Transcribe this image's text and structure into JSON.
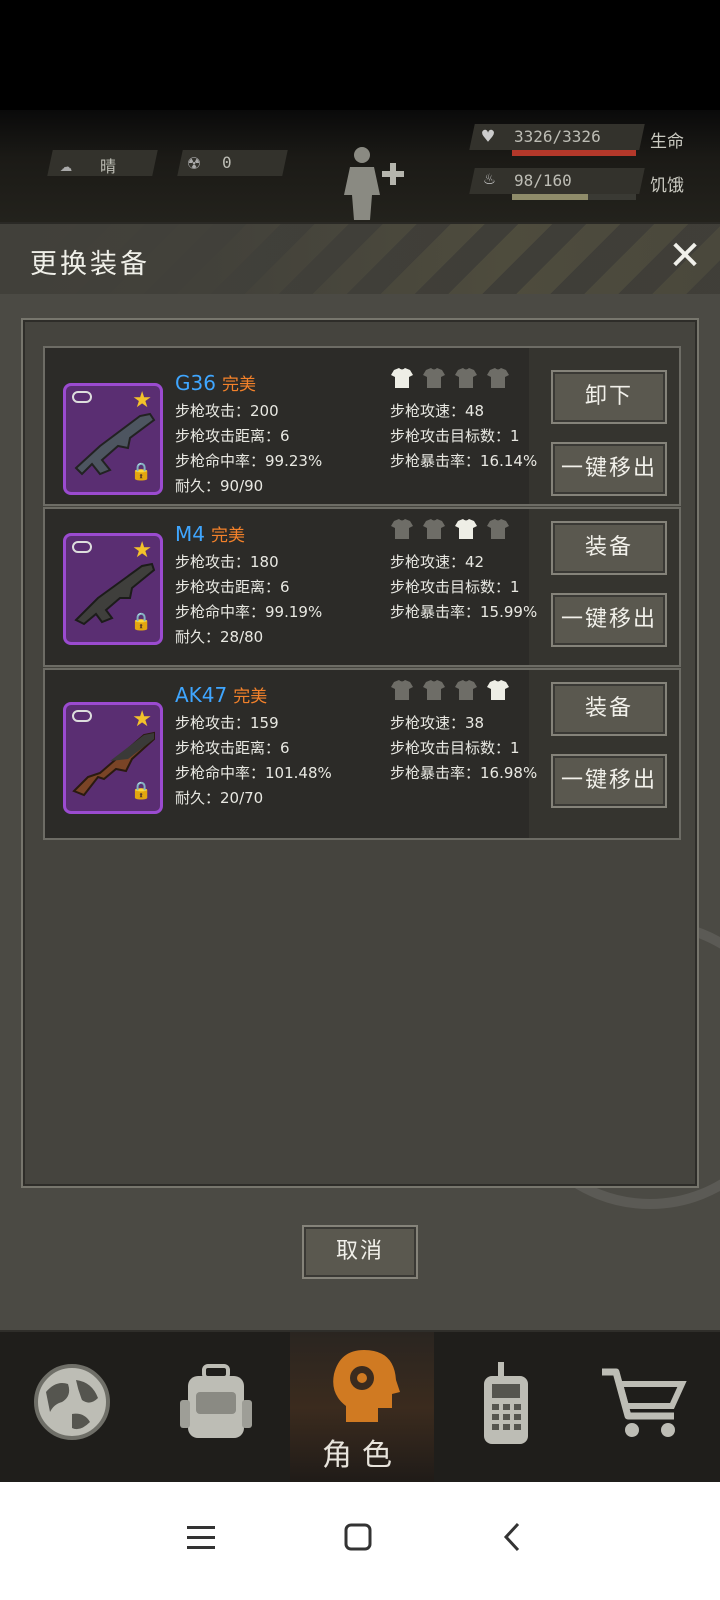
{
  "hud": {
    "weather": "晴",
    "radiation": "0",
    "hp": "3326/3326",
    "hp_label": "生命",
    "hunger": "98/160",
    "hunger_label": "饥饿"
  },
  "dialog": {
    "title": "更换装备",
    "close_icon": "close-icon",
    "cancel_label": "取消"
  },
  "items": [
    {
      "name": "G36",
      "quality": "完美",
      "attack": "步枪攻击：200",
      "range": "步枪攻击距离：6",
      "hit": "步枪命中率：99.23%",
      "durability": "耐久：90/90",
      "speed": "步枪攻速：48",
      "targets": "步枪攻击目标数：1",
      "crit": "步枪暴击率：16.14%",
      "action_label": "卸下",
      "remove_label": "一键移出",
      "highlight_slot": "1",
      "gems": "◆◆◆"
    },
    {
      "name": "M4",
      "quality": "完美",
      "attack": "步枪攻击：180",
      "range": "步枪攻击距离：6",
      "hit": "步枪命中率：99.19%",
      "durability": "耐久：28/80",
      "speed": "步枪攻速：42",
      "targets": "步枪攻击目标数：1",
      "crit": "步枪暴击率：15.99%",
      "action_label": "装备",
      "remove_label": "一键移出",
      "highlight_slot": "3"
    },
    {
      "name": "AK47",
      "quality": "完美",
      "attack": "步枪攻击：159",
      "range": "步枪攻击距离：6",
      "hit": "步枪命中率：101.48%",
      "durability": "耐久：20/70",
      "speed": "步枪攻速：38",
      "targets": "步枪攻击目标数：1",
      "crit": "步枪暴击率：16.98%",
      "action_label": "装备",
      "remove_label": "一键移出",
      "highlight_slot": "4"
    }
  ],
  "tabs": [
    {
      "icon": "globe-icon"
    },
    {
      "icon": "backpack-icon"
    },
    {
      "icon": "head-gear-icon",
      "label": "角色",
      "active": true
    },
    {
      "icon": "radio-icon"
    },
    {
      "icon": "cart-icon"
    }
  ],
  "colors": {
    "name_blue": "#3fa6ff",
    "quality_orange": "#f3812a",
    "hp_red": "#b3382a",
    "item_purple": "#9b4bd0"
  }
}
